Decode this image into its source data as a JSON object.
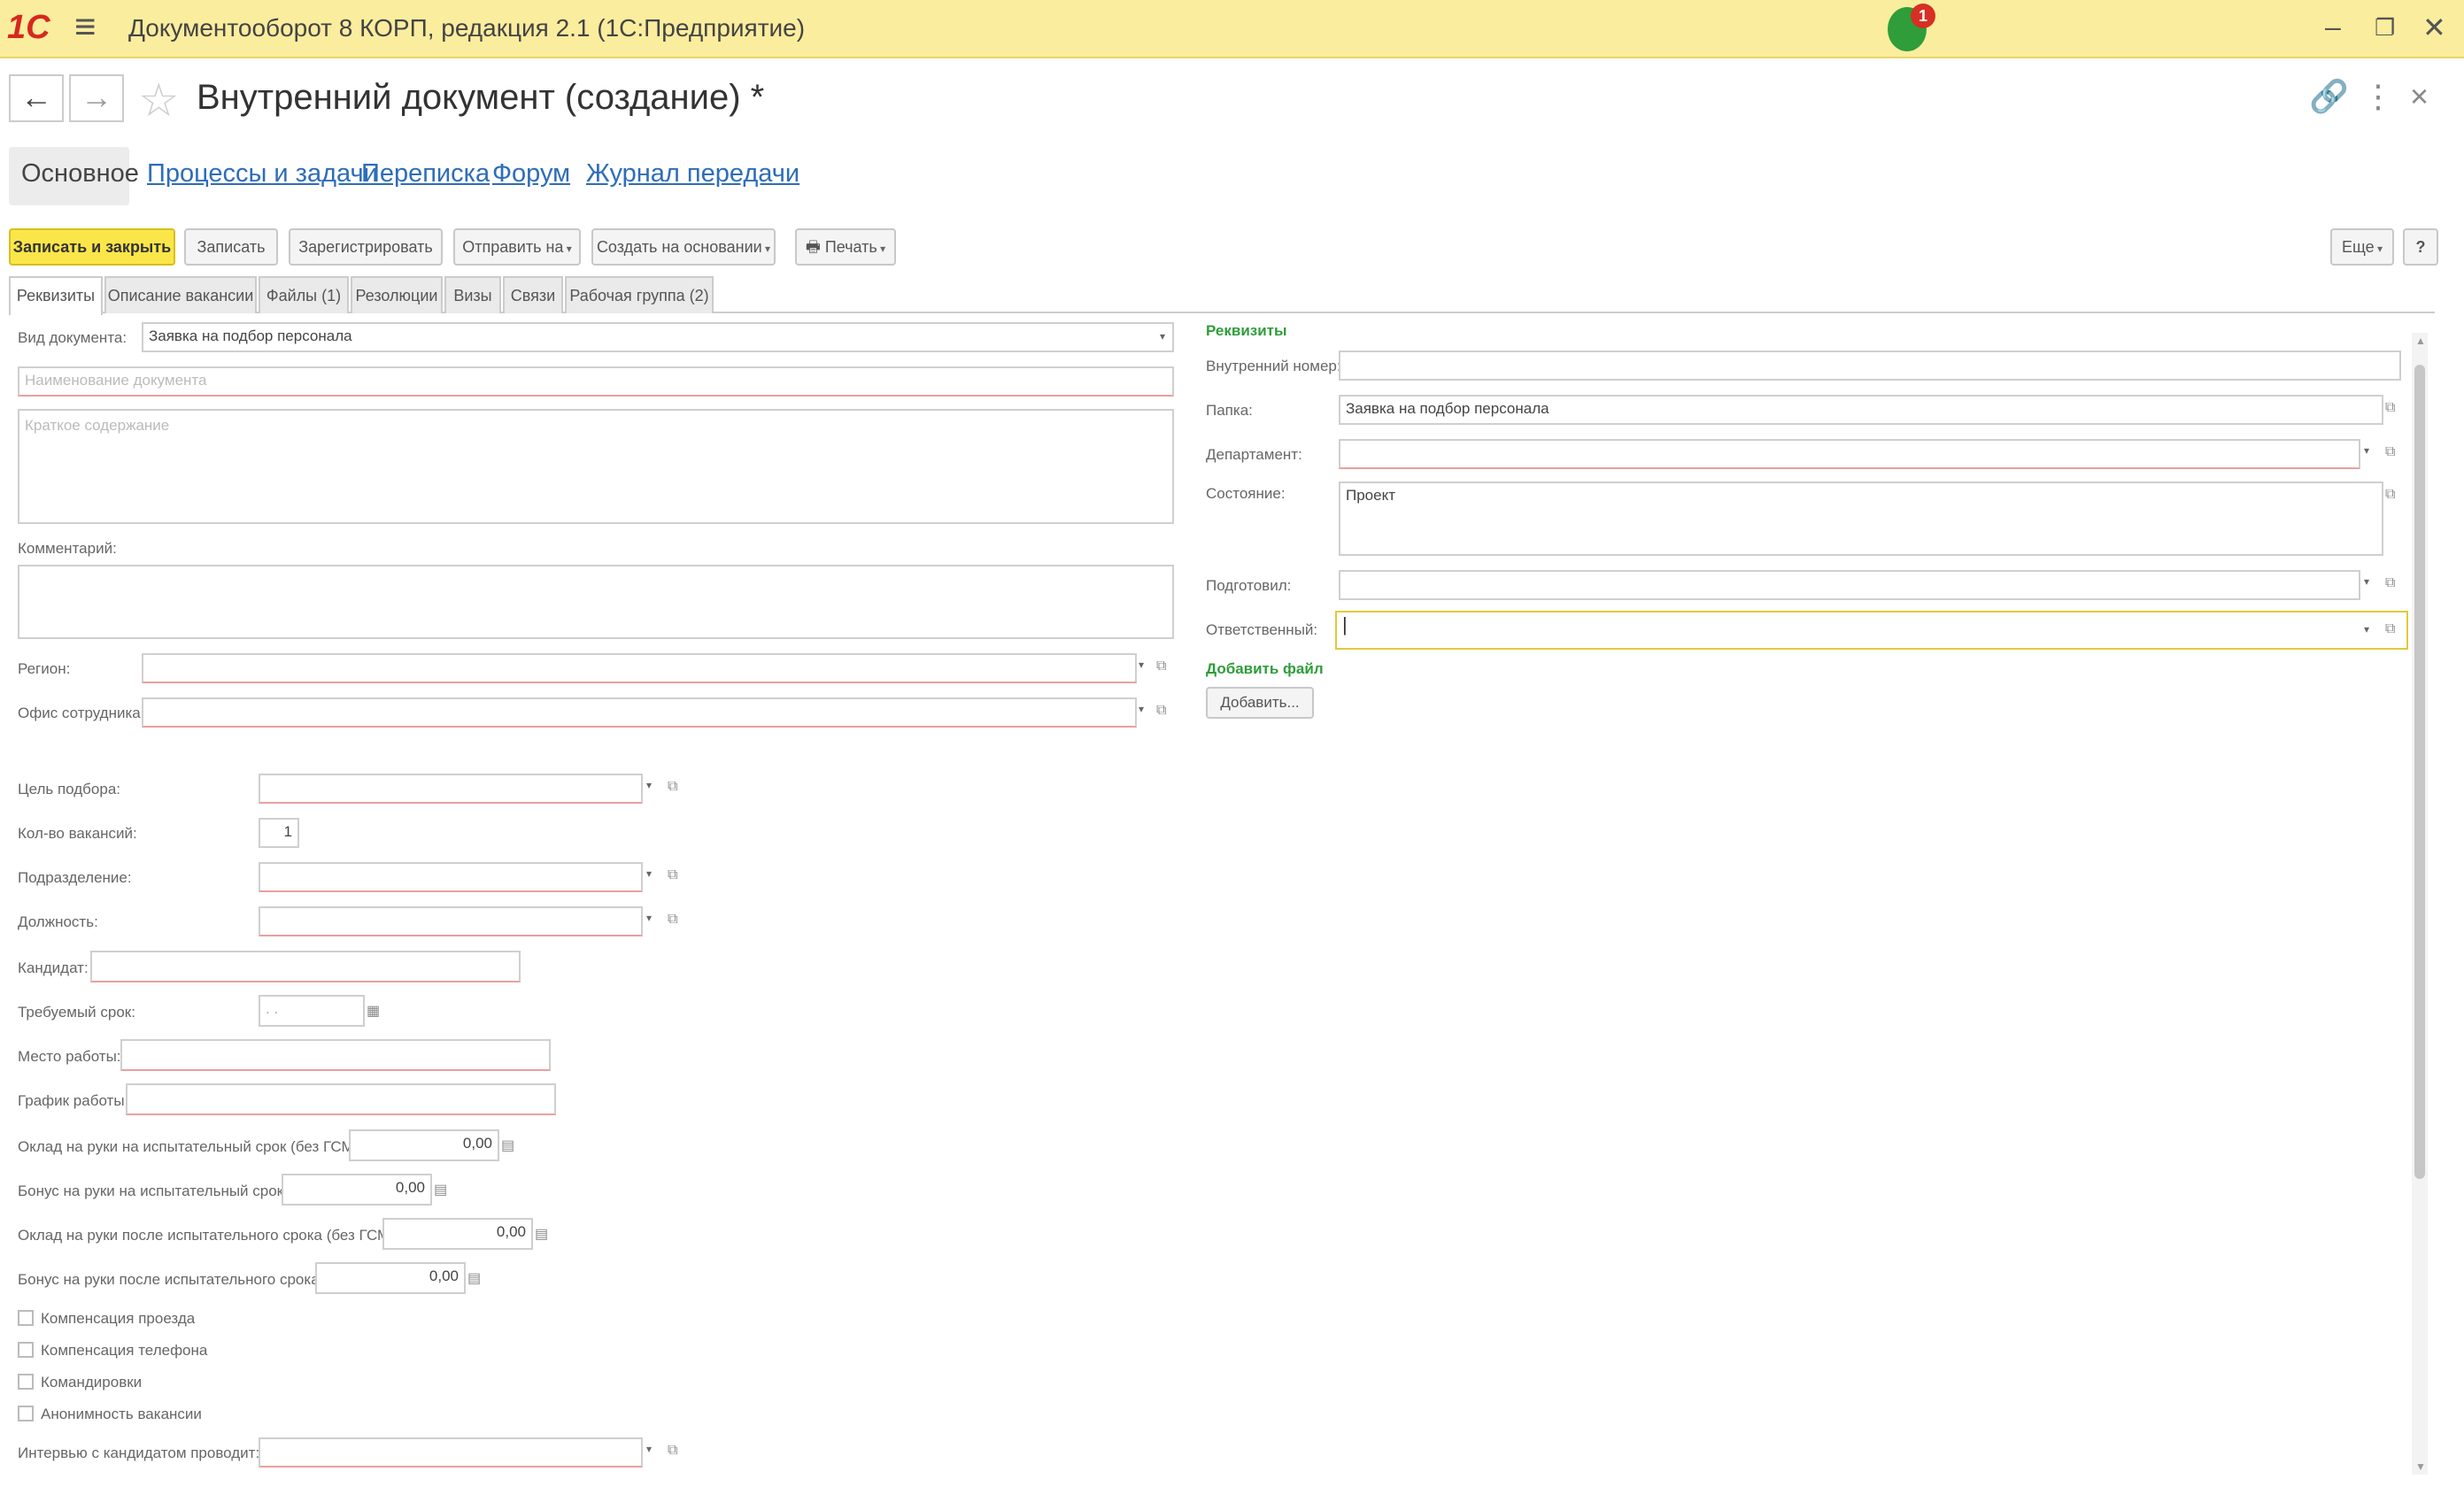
{
  "app": {
    "logo": "1С",
    "title": "Документооборот 8 КОРП, редакция 2.1  (1С:Предприятие)",
    "notification_count": "1",
    "colors": {
      "titlebar": "#fbed9e",
      "accent": "#fbe64a",
      "link": "#2e6db8",
      "group": "#2e9d3a"
    }
  },
  "header": {
    "back_icon": "←",
    "forward_icon": "→",
    "title": "Внутренний документ (создание) *",
    "link_icon": "🔗",
    "more_icon": "⋮",
    "close_icon": "×"
  },
  "section_tabs": [
    "Основное",
    "Процессы и задачи",
    "Переписка",
    "Форум",
    "Журнал передачи"
  ],
  "toolbar": {
    "save_close": "Записать и закрыть",
    "save": "Записать",
    "register": "Зарегистрировать",
    "send": "Отправить на",
    "create_based": "Создать на основании",
    "print": "Печать",
    "more": "Еще",
    "help": "?"
  },
  "form_tabs": [
    "Реквизиты",
    "Описание вакансии",
    "Файлы (1)",
    "Резолюции",
    "Визы",
    "Связи",
    "Рабочая группа (2)"
  ],
  "left": {
    "doc_type_label": "Вид документа:",
    "doc_type_value": "Заявка на подбор персонала",
    "name_placeholder": "Наименование документа",
    "summary_placeholder": "Краткое содержание",
    "comment_label": "Комментарий:",
    "region_label": "Регион:",
    "office_label": "Офис сотрудника:",
    "goal_label": "Цель подбора:",
    "vacancies_label": "Кол-во вакансий:",
    "vacancies_value": "1",
    "subdivision_label": "Подразделение:",
    "position_label": "Должность:",
    "candidate_label": "Кандидат:",
    "deadline_label": "Требуемый срок:",
    "deadline_value": ". .",
    "workplace_label": "Место работы:",
    "schedule_label": "График работы:",
    "salary_trial_label": "Оклад на руки на испытательный срок (без ГСМ):",
    "salary_trial_value": "0,00",
    "bonus_trial_label": "Бонус на руки на испытательный срок:",
    "bonus_trial_value": "0,00",
    "salary_after_label": "Оклад на руки после испытательного срока (без ГСМ):",
    "salary_after_value": "0,00",
    "bonus_after_label": "Бонус на руки после испытательного срока:",
    "bonus_after_value": "0,00",
    "chk_travel": "Компенсация проезда",
    "chk_phone": "Компенсация телефона",
    "chk_trips": "Командировки",
    "chk_anon": "Анонимность вакансии",
    "interview_label": "Интервью с кандидатом проводит:"
  },
  "right": {
    "group_title": "Реквизиты",
    "internal_number_label": "Внутренний номер:",
    "folder_label": "Папка:",
    "folder_value": "Заявка на подбор персонала",
    "department_label": "Департамент:",
    "state_label": "Состояние:",
    "state_value": "Проект",
    "prepared_label": "Подготовил:",
    "responsible_label": "Ответственный:",
    "add_file_title": "Добавить файл",
    "add_button": "Добавить..."
  }
}
